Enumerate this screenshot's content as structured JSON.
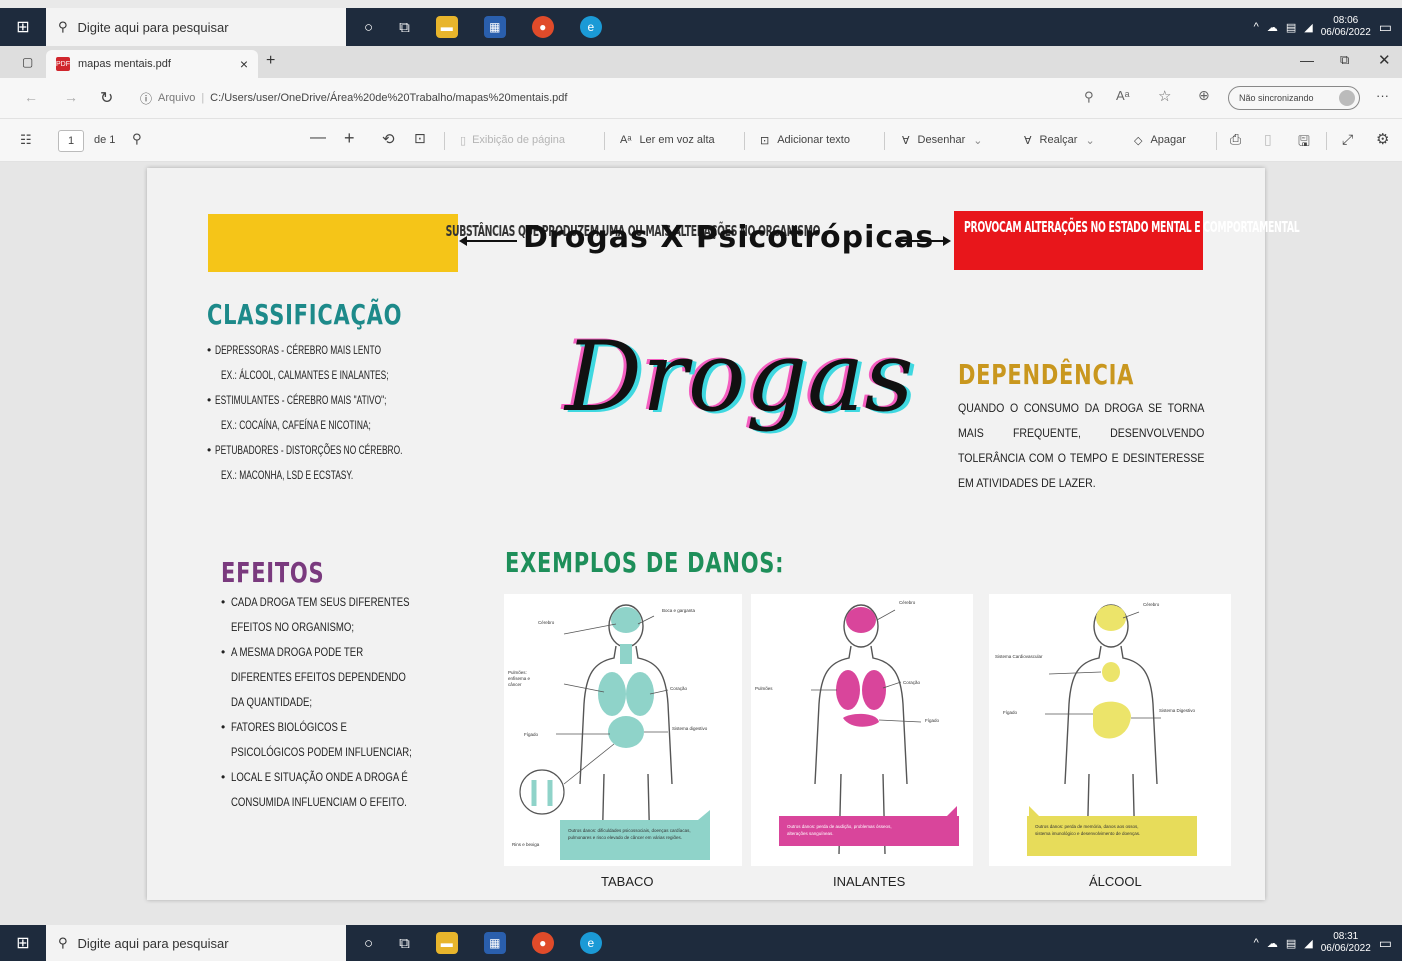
{
  "taskbar": {
    "search_placeholder": "Digite aqui para pesquisar",
    "clock_top": {
      "time": "08:06",
      "date": "06/06/2022"
    },
    "clock_bottom": {
      "time": "08:31",
      "date": "06/06/2022"
    }
  },
  "browser": {
    "tab_title": "mapas mentais.pdf",
    "tab_close": "×",
    "new_tab": "+",
    "address_prefix": "Arquivo",
    "address_url": "C:/Users/user/OneDrive/Área%20de%20Trabalho/mapas%20mentais.pdf",
    "profile_label": "Não sincronizando",
    "menu": "···"
  },
  "pdf_toolbar": {
    "page_number": "1",
    "page_of": "de 1",
    "zoom_out": "—",
    "zoom_in": "+",
    "page_view": "Exibição de página",
    "read_aloud": "Ler em voz alta",
    "add_text": "Adicionar texto",
    "draw": "Desenhar",
    "highlight": "Realçar",
    "erase": "Apagar"
  },
  "document": {
    "header_left": "SUBSTÂNCIAS QUE PRODUZEM UMA OU MAIS ALTERAÇÕES NO ORGANISMO",
    "header_center": "Drogas X Psicotrópicas",
    "header_right": "PROVOCAM ALTERAÇÕES NO ESTADO MENTAL E COMPORTAMENTAL",
    "big_title": "Drogas",
    "classificacao": {
      "title": "CLASSIFICAÇÃO",
      "items": [
        {
          "main": "DEPRESSORAS - CÉREBRO MAIS LENTO",
          "ex": "EX.: ÁLCOOL, CALMANTES E INALANTES;"
        },
        {
          "main": "ESTIMULANTES - CÉREBRO MAIS \"ATIVO\";",
          "ex": "EX.: COCAÍNA, CAFEÍNA E NICOTINA;"
        },
        {
          "main": "PETUBADORES - DISTORÇÕES NO CÉREBRO.",
          "ex": "EX.: MACONHA, LSD E ECSTASY."
        }
      ]
    },
    "dependencia": {
      "title": "DEPENDÊNCIA",
      "text": "QUANDO O CONSUMO DA DROGA SE TORNA MAIS FREQUENTE, DESENVOLVENDO TOLERÂNCIA COM O TEMPO E DESINTERESSE EM ATIVIDADES DE LAZER."
    },
    "efeitos": {
      "title": "EFEITOS",
      "items": [
        "CADA DROGA TEM SEUS DIFERENTES EFEITOS NO ORGANISMO;",
        "A MESMA DROGA PODE TER DIFERENTES EFEITOS DEPENDENDO DA QUANTIDADE;",
        "FATORES BIOLÓGICOS E PSICOLÓGICOS PODEM INFLUENCIAR;",
        "LOCAL E SITUAÇÃO ONDE A DROGA É CONSUMIDA INFLUENCIAM O EFEITO."
      ]
    },
    "danos_title": "EXEMPLOS DE DANOS:",
    "cards": [
      {
        "label": "TABACO",
        "color": "#8fd3c9",
        "box": "#8fd3c9"
      },
      {
        "label": "INALANTES",
        "color": "#d9459b",
        "box": "#d9459b"
      },
      {
        "label": "ÁLCOOL",
        "color": "#ece46a",
        "box": "#e7dc5a"
      }
    ]
  },
  "colors": {
    "yellow_box": "#f5c518",
    "red_box": "#e8161b",
    "teal": "#1d8a8a",
    "gold": "#c9971e",
    "purple": "#7a3a7e",
    "green": "#1e8f5a"
  }
}
